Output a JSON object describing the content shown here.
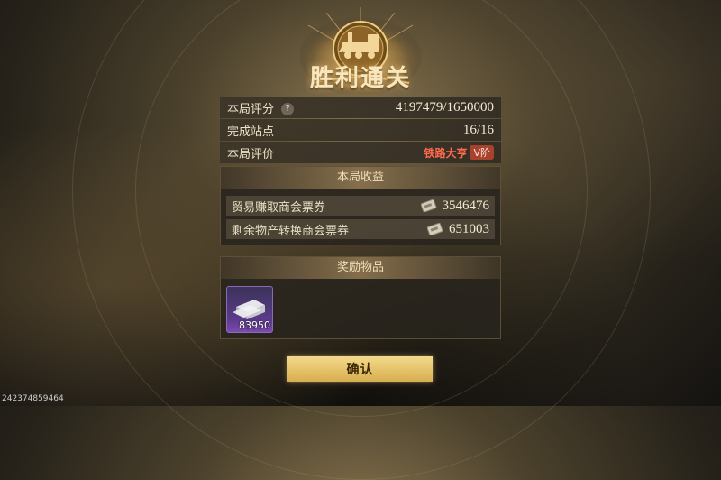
{
  "title": "胜利通关",
  "stats": {
    "score_label": "本局评分",
    "score_value": "4197479/1650000",
    "stations_label": "完成站点",
    "stations_value": "16/16",
    "rating_label": "本局评价",
    "rating_value": "铁路大亨",
    "rating_tier": "V阶"
  },
  "income": {
    "header": "本局收益",
    "rows": [
      {
        "label": "贸易赚取商会票券",
        "value": "3546476"
      },
      {
        "label": "剩余物产转换商会票券",
        "value": "651003"
      }
    ]
  },
  "rewards": {
    "header": "奖励物品",
    "items": [
      {
        "count": "83950",
        "icon": "silver-ingot-icon"
      }
    ]
  },
  "confirm_label": "确认",
  "user_id": "242374859464",
  "colors": {
    "accent": "#e6c46c",
    "badge": "#a8412d"
  }
}
